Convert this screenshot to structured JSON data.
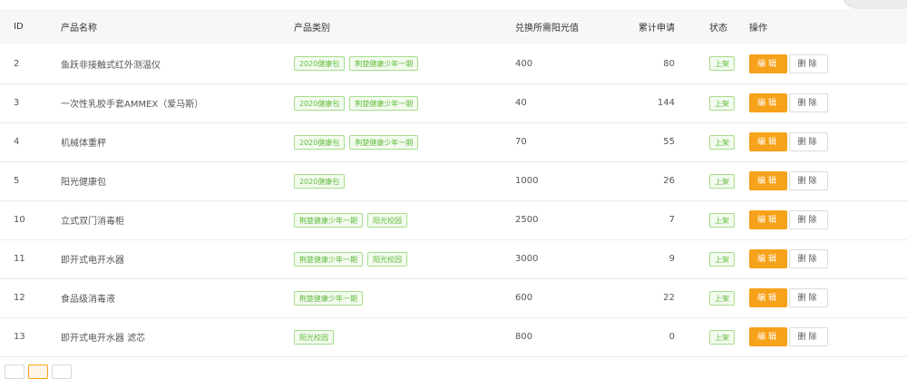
{
  "columns": {
    "id": "ID",
    "name": "产品名称",
    "category": "产品类别",
    "points": "兑换所需阳光值",
    "applications": "累计申请",
    "status": "状态",
    "actions": "操作"
  },
  "buttons": {
    "edit": "编辑",
    "delete": "删除"
  },
  "rows": [
    {
      "id": "2",
      "name": "鱼跃非接触式红外测温仪",
      "categories": [
        "2020健康包",
        "荆楚健康少年一期"
      ],
      "points": "400",
      "applications": "80",
      "status": "上架"
    },
    {
      "id": "3",
      "name": "一次性乳胶手套AMMEX（爱马斯）",
      "categories": [
        "2020健康包",
        "荆楚健康少年一期"
      ],
      "points": "40",
      "applications": "144",
      "status": "上架"
    },
    {
      "id": "4",
      "name": "机械体重秤",
      "categories": [
        "2020健康包",
        "荆楚健康少年一期"
      ],
      "points": "70",
      "applications": "55",
      "status": "上架"
    },
    {
      "id": "5",
      "name": "阳光健康包",
      "categories": [
        "2020健康包"
      ],
      "points": "1000",
      "applications": "26",
      "status": "上架"
    },
    {
      "id": "10",
      "name": "立式双门消毒柜",
      "categories": [
        "荆楚健康少年一期",
        "阳光校园"
      ],
      "points": "2500",
      "applications": "7",
      "status": "上架"
    },
    {
      "id": "11",
      "name": "即开式电开水器",
      "categories": [
        "荆楚健康少年一期",
        "阳光校园"
      ],
      "points": "3000",
      "applications": "9",
      "status": "上架"
    },
    {
      "id": "12",
      "name": "食品级消毒液",
      "categories": [
        "荆楚健康少年一期"
      ],
      "points": "600",
      "applications": "22",
      "status": "上架"
    },
    {
      "id": "13",
      "name": "即开式电开水器 滤芯",
      "categories": [
        "阳光校园"
      ],
      "points": "800",
      "applications": "0",
      "status": "上架"
    }
  ],
  "colors": {
    "accent": "#f7a21b",
    "tag_green": "#61bb3c",
    "header_bg": "#f7f7f7"
  }
}
